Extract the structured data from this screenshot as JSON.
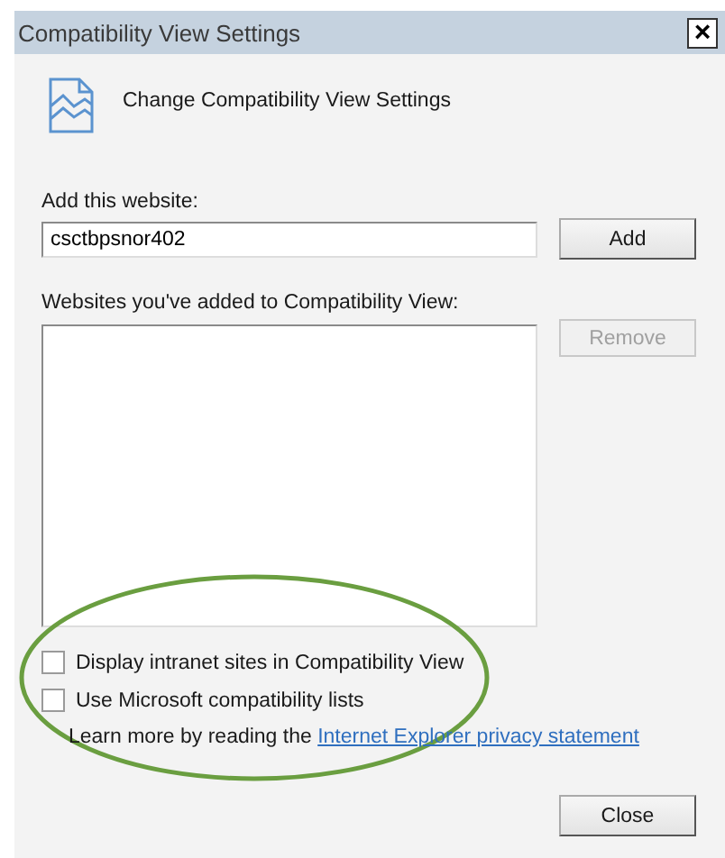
{
  "window": {
    "title": "Compatibility View Settings",
    "close_glyph": "×"
  },
  "header": "Change Compatibility View Settings",
  "add_website": {
    "label": "Add this website:",
    "value": "csctbpsnor402",
    "button": "Add"
  },
  "added_list": {
    "label": "Websites you've added to Compatibility View:",
    "remove_button": {
      "label": "Remove",
      "disabled": true
    }
  },
  "options": [
    {
      "label": "Display intranet sites in Compatibility View",
      "checked": false
    },
    {
      "label": "Use Microsoft compatibility lists",
      "checked": false
    }
  ],
  "learn_more": {
    "text": "Learn more by reading the",
    "link": "Internet Explorer privacy statement"
  },
  "close_button": "Close"
}
